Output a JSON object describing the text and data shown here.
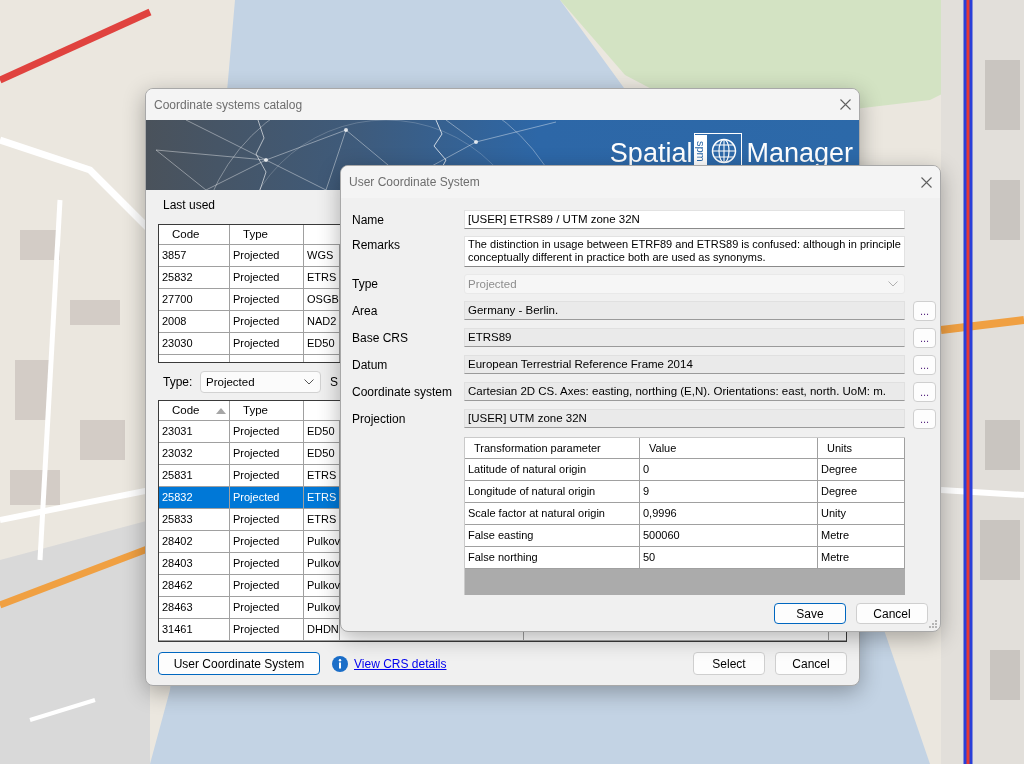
{
  "catalog_window": {
    "title": "Coordinate systems catalog",
    "banner": {
      "logo_word_1": "Spatial",
      "logo_mark": "spm",
      "logo_word_2": "Manager"
    },
    "last_used": {
      "label": "Last used",
      "columns": [
        {
          "label": "Code",
          "sorted": false
        },
        {
          "label": "Type",
          "sorted": false
        }
      ],
      "rows": [
        {
          "code": "3857",
          "type": "Projected",
          "column_3": "WGS"
        },
        {
          "code": "25832",
          "type": "Projected",
          "column_3": "ETRS"
        },
        {
          "code": "27700",
          "type": "Projected",
          "column_3": "OSGB"
        },
        {
          "code": "2008",
          "type": "Projected",
          "column_3": "NAD2"
        },
        {
          "code": "23030",
          "type": "Projected",
          "column_3": "ED50"
        }
      ]
    },
    "type_filter": {
      "label": "Type:",
      "value": "Projected"
    },
    "search_label": "S",
    "catalog_table": {
      "columns": [
        {
          "label": "Code",
          "sorted": true
        },
        {
          "label": "Type",
          "sorted": false
        }
      ],
      "rows": [
        {
          "code": "23031",
          "type": "Projected",
          "column_3": "ED50",
          "selected": false
        },
        {
          "code": "23032",
          "type": "Projected",
          "column_3": "ED50",
          "selected": false
        },
        {
          "code": "25831",
          "type": "Projected",
          "column_3": "ETRS",
          "selected": false
        },
        {
          "code": "25832",
          "type": "Projected",
          "column_3": "ETRS",
          "selected": true
        },
        {
          "code": "25833",
          "type": "Projected",
          "column_3": "ETRS",
          "selected": false
        },
        {
          "code": "28402",
          "type": "Projected",
          "column_3": "Pulkov",
          "selected": false
        },
        {
          "code": "28403",
          "type": "Projected",
          "column_3": "Pulkov",
          "selected": false
        },
        {
          "code": "28462",
          "type": "Projected",
          "column_3": "Pulkov",
          "selected": false
        },
        {
          "code": "28463",
          "type": "Projected",
          "column_3": "Pulkov",
          "selected": false
        },
        {
          "code": "31461",
          "type": "Projected",
          "column_3": "DHDN",
          "selected": false
        }
      ]
    },
    "user_crs_button": {
      "label": "User Coordinate System",
      "default": true
    },
    "details_link": "View CRS details",
    "buttons": [
      {
        "label": "Select",
        "default": false
      },
      {
        "label": "Cancel",
        "default": false
      }
    ]
  },
  "user_crs_dialog": {
    "title": "User Coordinate System",
    "fields": [
      {
        "kind": "text",
        "label": "Name",
        "value": "[USER] ETRS89 / UTM zone 32N",
        "disabled": false
      },
      {
        "kind": "textarea",
        "label": "Remarks",
        "value": "The distinction in usage between ETRF89 and ETRS89 is confused: although in principle conceptually different in practice both are used as synonyms.",
        "disabled": false
      },
      {
        "kind": "select",
        "label": "Type",
        "value": "Projected",
        "disabled": true
      },
      {
        "kind": "picker",
        "label": "Area",
        "value": "Germany - Berlin.",
        "button": "...",
        "disabled": false
      },
      {
        "kind": "picker",
        "label": "Base CRS",
        "value": "ETRS89",
        "button": "...",
        "disabled": false
      },
      {
        "kind": "picker",
        "label": "Datum",
        "value": "European Terrestrial Reference Frame 2014",
        "button": "...",
        "disabled": false
      },
      {
        "kind": "picker",
        "label": "Coordinate system",
        "value": "Cartesian 2D CS. Axes: easting, northing (E,N). Orientations: east, north. UoM: m.",
        "button": "...",
        "disabled": false
      },
      {
        "kind": "picker",
        "label": "Projection",
        "value": "[USER] UTM zone 32N",
        "button": "...",
        "disabled": false
      }
    ],
    "parameters": {
      "columns": [
        "Transformation parameter",
        "Value",
        "Units"
      ],
      "rows": [
        {
          "parameter": "Latitude of natural origin",
          "value": "0",
          "units": "Degree"
        },
        {
          "parameter": "Longitude of natural origin",
          "value": "9",
          "units": "Degree"
        },
        {
          "parameter": "Scale factor at natural origin",
          "value": "0,9996",
          "units": "Unity"
        },
        {
          "parameter": "False easting",
          "value": "500060",
          "units": "Metre"
        },
        {
          "parameter": "False northing",
          "value": "50",
          "units": "Metre"
        }
      ]
    },
    "buttons": [
      {
        "label": "Save",
        "default": true
      },
      {
        "label": "Cancel",
        "default": false
      }
    ]
  }
}
